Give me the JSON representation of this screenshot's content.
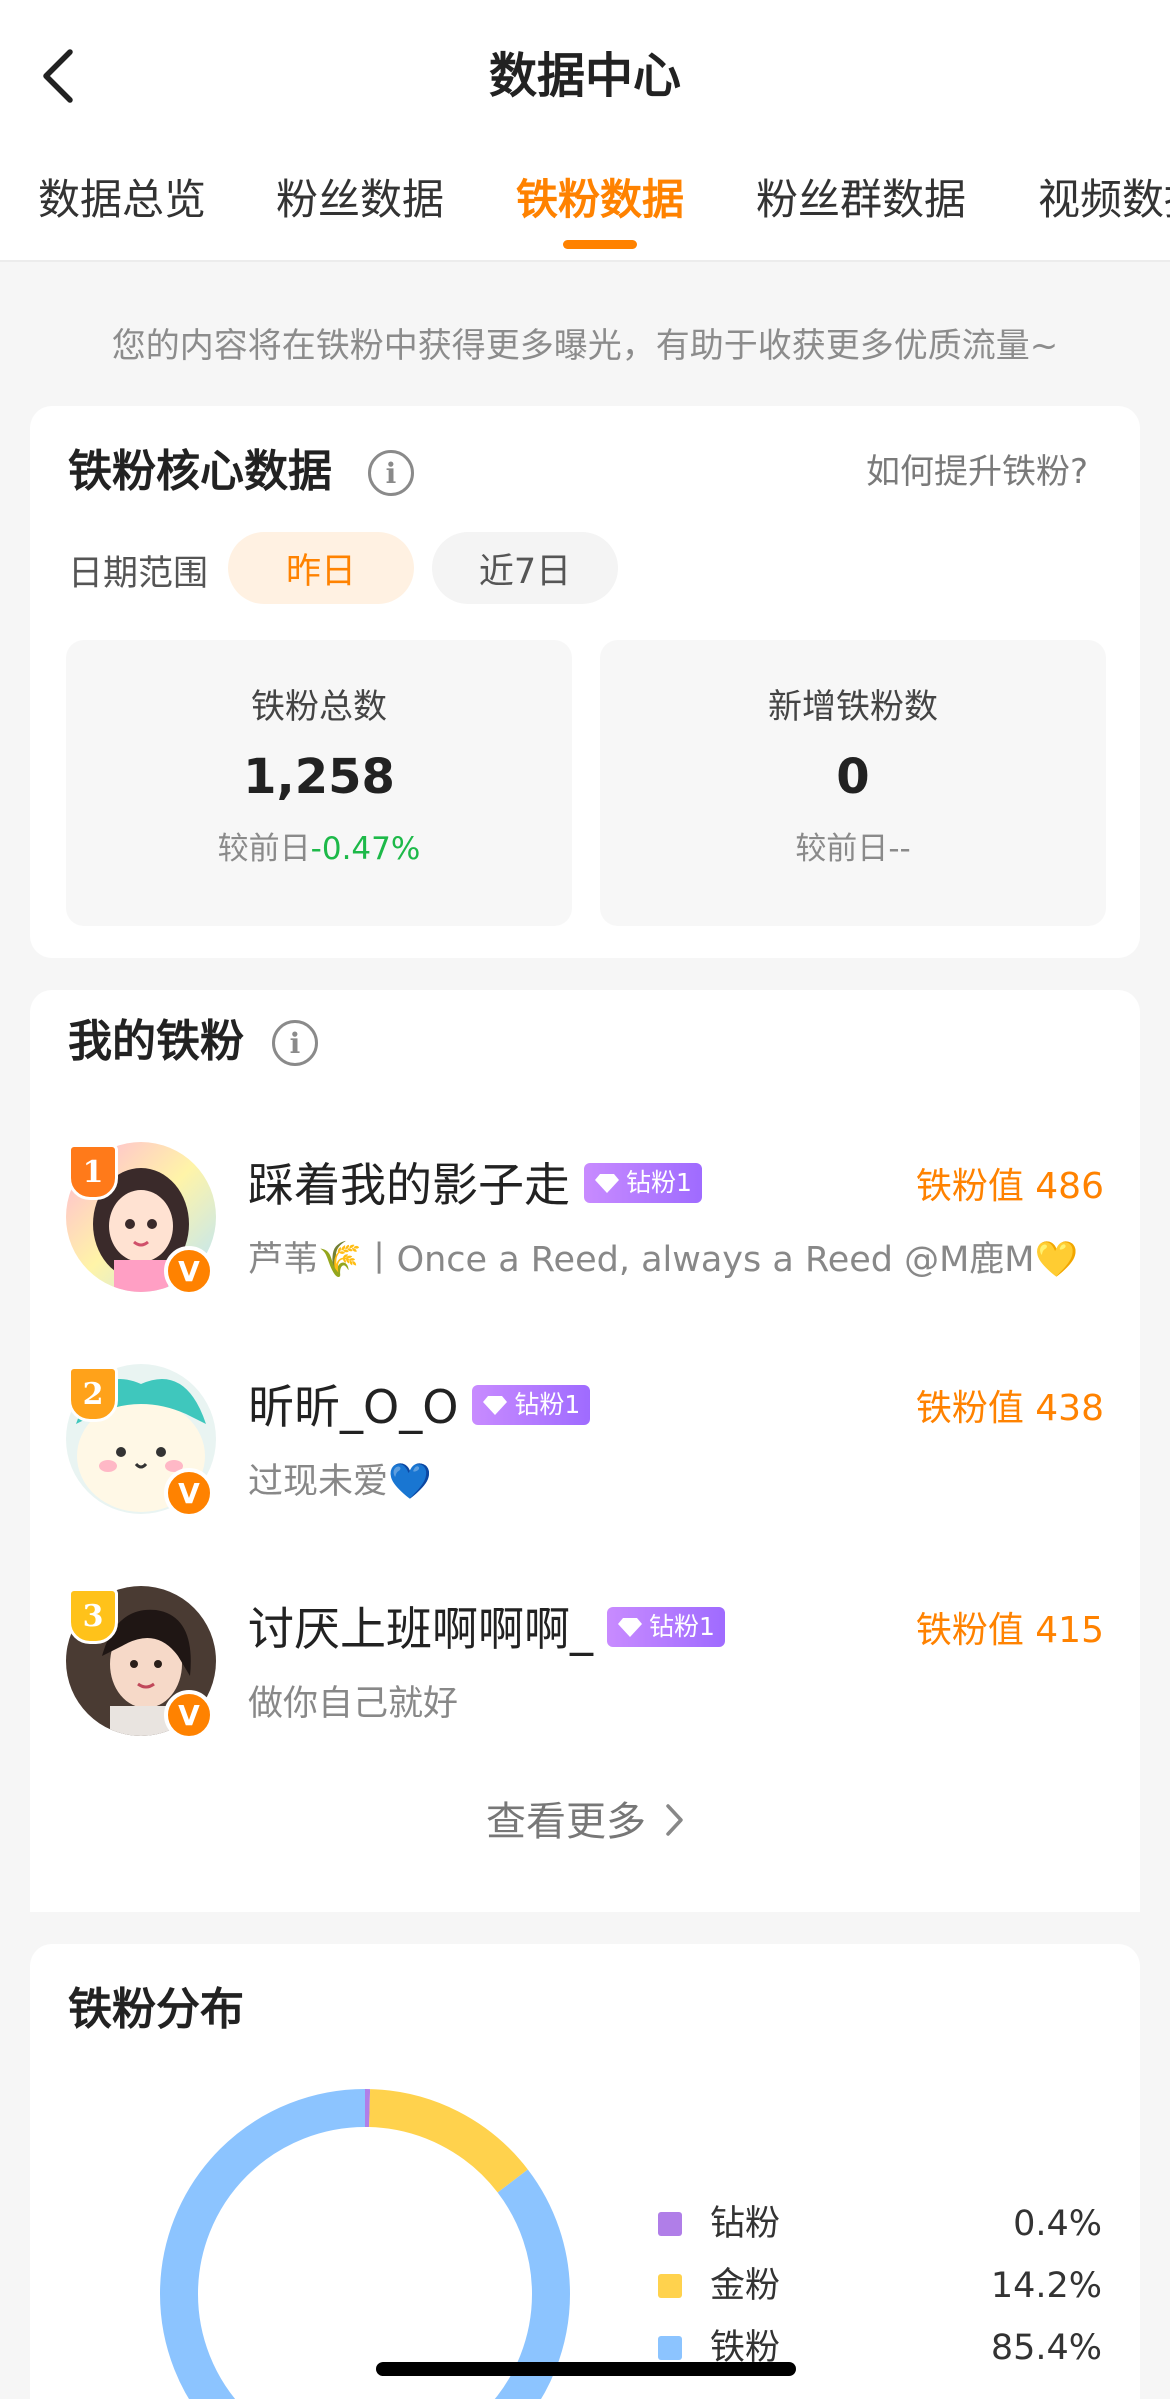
{
  "header": {
    "title": "数据中心"
  },
  "tabs": [
    {
      "label": "数据总览"
    },
    {
      "label": "粉丝数据"
    },
    {
      "label": "铁粉数据"
    },
    {
      "label": "粉丝群数据"
    },
    {
      "label": "视频数据"
    }
  ],
  "active_tab": "铁粉数据",
  "notice": "您的内容将在铁粉中获得更多曝光，有助于收获更多优质流量~",
  "core": {
    "title": "铁粉核心数据",
    "how_link": "如何提升铁粉?",
    "range_label": "日期范围",
    "range_options": [
      "昨日",
      "近7日"
    ],
    "selected_range": "昨日",
    "stats": [
      {
        "label": "铁粉总数",
        "value": "1,258",
        "compare_prefix": "较前日",
        "compare_value": "-0.47%"
      },
      {
        "label": "新增铁粉数",
        "value": "0",
        "compare_prefix": "较前日",
        "compare_value": "--"
      }
    ]
  },
  "fans": {
    "title": "我的铁粉",
    "items": [
      {
        "rank": "1",
        "name": "踩着我的影子走",
        "level": "钻粉1",
        "score_label": "铁粉值",
        "score": "486",
        "bio": "芦苇🌾丨Once a Reed, always a Reed @M鹿M💛"
      },
      {
        "rank": "2",
        "name": "昕昕_O_O",
        "level": "钻粉1",
        "score_label": "铁粉值",
        "score": "438",
        "bio": "过现未爱💙"
      },
      {
        "rank": "3",
        "name": "讨厌上班啊啊啊_",
        "level": "钻粉1",
        "score_label": "铁粉值",
        "score": "415",
        "bio": "做你自己就好"
      }
    ],
    "see_more": "查看更多"
  },
  "distribution": {
    "title": "铁粉分布",
    "items": [
      {
        "label": "钻粉",
        "pct_text": "0.4%",
        "value": 0.4,
        "color": "#b07ee8"
      },
      {
        "label": "金粉",
        "pct_text": "14.2%",
        "value": 14.2,
        "color": "#ffd24d"
      },
      {
        "label": "铁粉",
        "pct_text": "85.4%",
        "value": 85.4,
        "color": "#8cc4ff"
      }
    ]
  },
  "colors": {
    "accent": "#ff8200",
    "down": "#1db949",
    "badge": "#a97bff"
  }
}
